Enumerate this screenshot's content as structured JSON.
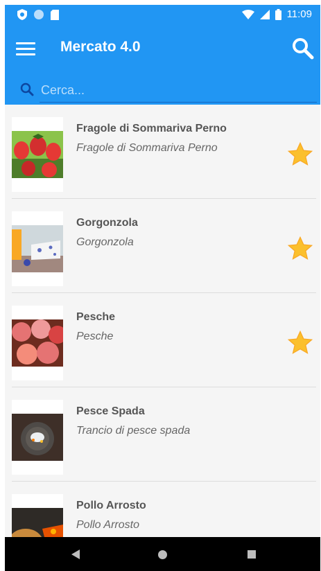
{
  "status_bar": {
    "time": "11:09"
  },
  "app_bar": {
    "title": "Mercato 4.0"
  },
  "search": {
    "placeholder": "Cerca..."
  },
  "colors": {
    "primary": "#2196f3",
    "star": "#fbc02d"
  },
  "items": [
    {
      "name": "Fragole di Sommariva Perno",
      "description": "Fragole di Sommariva Perno",
      "favorite": true
    },
    {
      "name": "Gorgonzola",
      "description": "Gorgonzola",
      "favorite": true
    },
    {
      "name": "Pesche",
      "description": "Pesche",
      "favorite": true
    },
    {
      "name": "Pesce Spada",
      "description": "Trancio di pesce spada",
      "favorite": false
    },
    {
      "name": "Pollo Arrosto",
      "description": "Pollo Arrosto",
      "favorite": false
    }
  ]
}
